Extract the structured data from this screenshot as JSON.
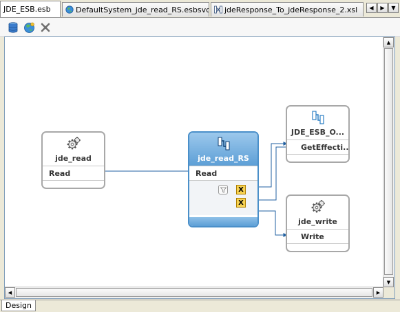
{
  "tabs": [
    {
      "label": "JDE_ESB.esb",
      "icon": "esb-icon",
      "active": true
    },
    {
      "label": "DefaultSystem_jde_read_RS.esbsvc",
      "icon": "globe-icon",
      "active": false
    },
    {
      "label": "jdeResponse_To_jdeResponse_2.xsl",
      "icon": "xsl-map-icon",
      "active": false
    }
  ],
  "tab_nav": {
    "left": "◀",
    "right": "▶",
    "menu": "▼"
  },
  "toolbar": {
    "icons": [
      "database-icon",
      "globe-icon",
      "delete-icon"
    ]
  },
  "colors": {
    "selection": "#5d9fd6",
    "wire": "#1f5fa0",
    "xform": "#f7d253",
    "node_border": "#a8a8a8"
  },
  "diagram": {
    "jde_read": {
      "title": "jde_read",
      "operation": "Read",
      "icon": "adapter-gear-icon"
    },
    "jde_read_rs": {
      "title": "jde_read_RS",
      "operation": "Read",
      "icon": "routing-service-icon",
      "xform_label": "X"
    },
    "jde_esb_o": {
      "title": "JDE_ESB_O...",
      "operation": "GetEffecti...",
      "icon": "routing-service-icon"
    },
    "jde_write": {
      "title": "jde_write",
      "operation": "Write",
      "icon": "adapter-gear-icon"
    }
  },
  "scroll": {
    "up": "▲",
    "down": "▼",
    "left": "◀",
    "right": "▶"
  },
  "bottom_tabs": [
    {
      "label": "Design"
    }
  ]
}
